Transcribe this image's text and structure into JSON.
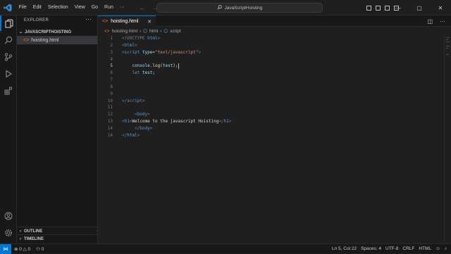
{
  "window": {
    "title": "JavaScriptHoisting",
    "menu": [
      "File",
      "Edit",
      "Selection",
      "View",
      "Go",
      "Run",
      "···"
    ]
  },
  "sidebar": {
    "title": "EXPLORER",
    "folder": "JAVASCRIPTHOISTING",
    "file": "hoisting.html",
    "sections": [
      "OUTLINE",
      "TIMELINE"
    ]
  },
  "editor": {
    "tab_label": "hoisting.html",
    "breadcrumb": [
      "hoisting.html",
      "html",
      "script"
    ],
    "lines": [
      {
        "n": "1",
        "tokens": [
          {
            "t": "<!DOCTYPE ",
            "c": "br"
          },
          {
            "t": "html",
            "c": "tag"
          },
          {
            "t": ">",
            "c": "br"
          }
        ]
      },
      {
        "n": "2",
        "tokens": [
          {
            "t": "<",
            "c": "br"
          },
          {
            "t": "html",
            "c": "tag"
          },
          {
            "t": ">",
            "c": "br"
          }
        ]
      },
      {
        "n": "3",
        "tokens": [
          {
            "t": "<",
            "c": "br"
          },
          {
            "t": "script",
            "c": "tag"
          },
          {
            "t": " ",
            "c": "txt"
          },
          {
            "t": "type",
            "c": "attr"
          },
          {
            "t": "=",
            "c": "txt"
          },
          {
            "t": "\"text/javascript\"",
            "c": "str"
          },
          {
            "t": ">",
            "c": "br"
          }
        ]
      },
      {
        "n": "4",
        "tokens": []
      },
      {
        "n": "5",
        "tokens": [
          {
            "t": "    ",
            "c": "txt"
          },
          {
            "t": "console",
            "c": "var"
          },
          {
            "t": ".",
            "c": "txt"
          },
          {
            "t": "log",
            "c": "fn"
          },
          {
            "t": "(",
            "c": "txt"
          },
          {
            "t": "test",
            "c": "var"
          },
          {
            "t": ");",
            "c": "txt"
          }
        ],
        "cursor": true
      },
      {
        "n": "6",
        "tokens": [
          {
            "t": "    ",
            "c": "txt"
          },
          {
            "t": "let",
            "c": "kw"
          },
          {
            "t": " ",
            "c": "txt"
          },
          {
            "t": "test",
            "c": "var"
          },
          {
            "t": ";",
            "c": "txt"
          }
        ]
      },
      {
        "n": "7",
        "tokens": []
      },
      {
        "n": "8",
        "tokens": []
      },
      {
        "n": "9",
        "tokens": []
      },
      {
        "n": "10",
        "tokens": [
          {
            "t": "</",
            "c": "br"
          },
          {
            "t": "script",
            "c": "tag"
          },
          {
            "t": ">",
            "c": "br"
          }
        ]
      },
      {
        "n": "11",
        "tokens": []
      },
      {
        "n": "12",
        "tokens": [
          {
            "t": "     ",
            "c": "txt"
          },
          {
            "t": "<",
            "c": "br"
          },
          {
            "t": "body",
            "c": "tag"
          },
          {
            "t": ">",
            "c": "br"
          }
        ]
      },
      {
        "n": "13",
        "tokens": [
          {
            "t": "<",
            "c": "br"
          },
          {
            "t": "h1",
            "c": "tag"
          },
          {
            "t": ">",
            "c": "br"
          },
          {
            "t": "Welcome to the javascript Hoisting",
            "c": "txt"
          },
          {
            "t": "</",
            "c": "br"
          },
          {
            "t": "h1",
            "c": "tag"
          },
          {
            "t": ">",
            "c": "br"
          }
        ]
      },
      {
        "n": "14",
        "tokens": [
          {
            "t": "     ",
            "c": "txt"
          },
          {
            "t": "</",
            "c": "br"
          },
          {
            "t": "body",
            "c": "tag"
          },
          {
            "t": ">",
            "c": "br"
          }
        ]
      },
      {
        "n": "14",
        "tokens": [
          {
            "t": "</",
            "c": "br"
          },
          {
            "t": "html",
            "c": "tag"
          },
          {
            "t": ">",
            "c": "br"
          }
        ]
      }
    ],
    "current_line": "5"
  },
  "status": {
    "problems": "0 △ 0",
    "right": [
      "Ln 5, Col 22",
      "Spaces: 4",
      "UTF-8",
      "CRLF",
      "HTML"
    ]
  },
  "colors": {
    "accent": "#0078d4",
    "bg": "#1f1f1f",
    "sidebar": "#181818"
  }
}
